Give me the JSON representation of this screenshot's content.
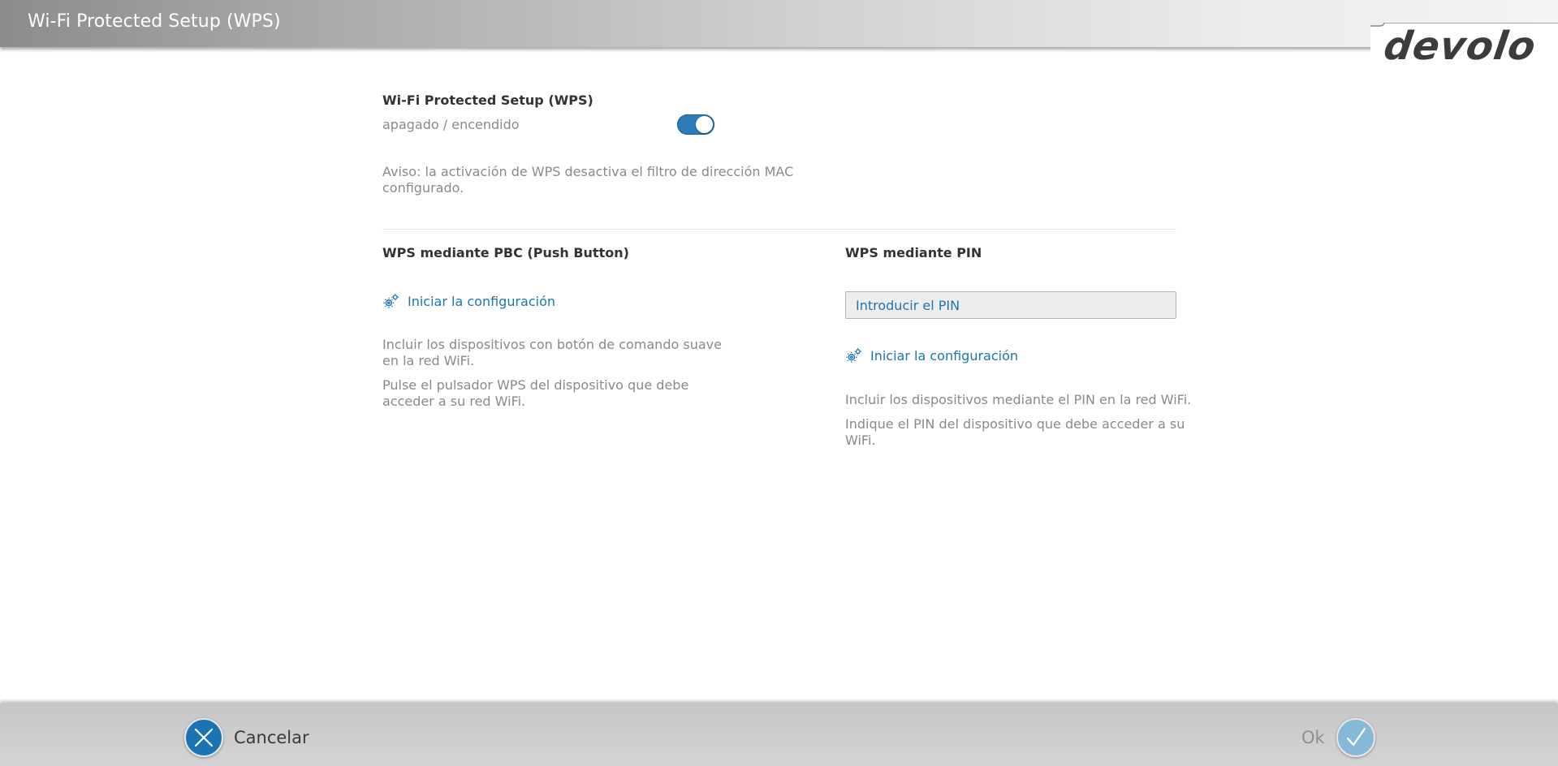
{
  "header": {
    "title": "Wi-Fi Protected Setup (WPS)",
    "logo_text": "devolo"
  },
  "wps": {
    "title": "Wi-Fi Protected Setup (WPS)",
    "toggle_label": "apagado / encendido",
    "toggle_on": true,
    "notice_line1": "Aviso: la activación de WPS desactiva el filtro de dirección MAC",
    "notice_line2": "configurado."
  },
  "pbc": {
    "title": "WPS mediante PBC (Push Button)",
    "start_link": "Iniciar la configuración",
    "desc1_line1": "Incluir los dispositivos con botón de comando suave",
    "desc1_line2": "en la red WiFi.",
    "desc2_line1": "Pulse el pulsador WPS del dispositivo que debe",
    "desc2_line2": "acceder a su red WiFi."
  },
  "pin": {
    "title": "WPS mediante PIN",
    "input_placeholder": "Introducir el PIN",
    "input_value": "",
    "start_link": "Iniciar la configuración",
    "desc1": "Incluir los dispositivos mediante el PIN en la red WiFi.",
    "desc2_line1": "Indique el PIN del dispositivo que debe acceder a su",
    "desc2_line2": "WiFi."
  },
  "footer": {
    "cancel_label": "Cancelar",
    "ok_label": "Ok"
  },
  "colors": {
    "accent": "#1f74b4",
    "toggle_on": "#2d7cb9",
    "muted_text": "#8a8a8a"
  },
  "icons": {
    "cancel": "close-icon",
    "ok": "checkmark-icon",
    "start": "gears-icon"
  }
}
